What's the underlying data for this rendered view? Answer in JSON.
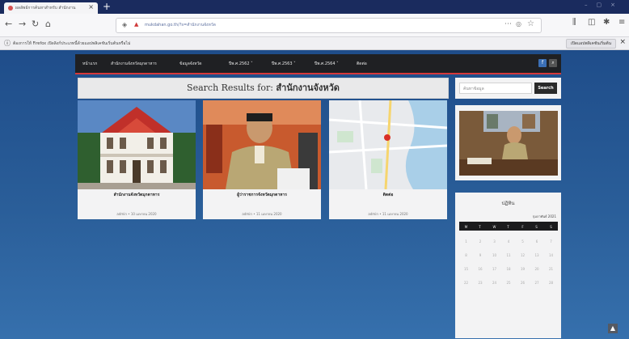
{
  "browser": {
    "tab_title": "ผลลัพธ์การค้นหาสำหรับ สำนักงาน",
    "url": "mukdahan.go.th/?s=สำนักงานจังหวัด",
    "info_text": "ต้องการให้ Firefox เปิดลิงก์ประเภทนี้ด้วยแอปพลิเคชันเริ่มต้นหรือไม่",
    "info_button": "เปิดแอปพลิเคชันเริ่มต้น"
  },
  "nav": {
    "items": [
      "หน้าแรก",
      "สำนักงานจังหวัดมุกดาหาร",
      "ข้อมูลจังหวัด",
      "ปีพ.ศ.2562 ˅",
      "ปีพ.ศ.2563 ˅",
      "ปีพ.ศ.2564 ˅",
      "ติดต่อ"
    ]
  },
  "search": {
    "heading_prefix": "Search Results for:",
    "query": "สำนักงานจังหวัด"
  },
  "results": [
    {
      "title": "สำนักงานจังหวัดมุกดาหาร",
      "meta": "admin • 10 เมษายน 2020"
    },
    {
      "title": "ผู้ว่าราชการจังหวัดมุกดาหาร",
      "meta": "admin • 11 เมษายน 2020"
    },
    {
      "title": "ติดต่อ",
      "meta": "admin • 11 เมษายน 2020"
    }
  ],
  "sidebar": {
    "search_placeholder": "ค้นหาข้อมูล",
    "search_button": "Search",
    "calendar_title": "ปฏิทิน",
    "calendar_month": "กุมภาพันธ์ 2021",
    "weekdays": [
      "M",
      "T",
      "W",
      "T",
      "F",
      "S",
      "S"
    ],
    "days": [
      "1",
      "2",
      "3",
      "4",
      "5",
      "6",
      "7",
      "8",
      "9",
      "10",
      "11",
      "12",
      "13",
      "14",
      "15",
      "16",
      "17",
      "18",
      "19",
      "20",
      "21",
      "22",
      "23",
      "24",
      "25",
      "26",
      "27",
      "28"
    ]
  },
  "colors": {
    "nav_bg": "#1f2023",
    "accent_red": "#d6393a",
    "page_blue": "#2a5e99"
  }
}
